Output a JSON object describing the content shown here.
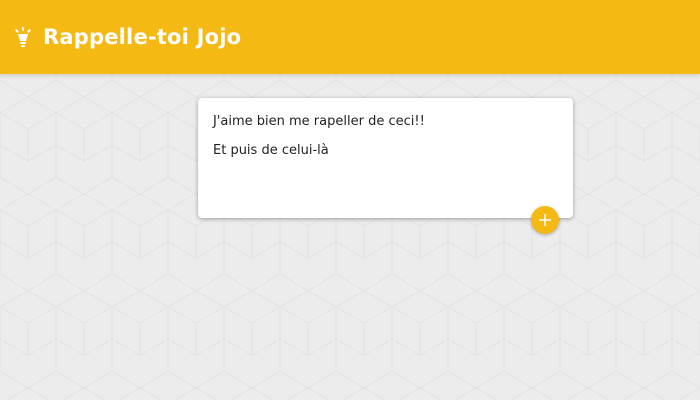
{
  "app": {
    "title": "Rappelle-toi Jojo",
    "logo_icon": "lightbulb-icon"
  },
  "colors": {
    "accent": "#f5b914",
    "background": "#ececec",
    "card": "#ffffff",
    "text": "#222222"
  },
  "note": {
    "lines": [
      "J'aime bien me rapeller de ceci!!",
      "Et puis de celui-là"
    ]
  },
  "add_button": {
    "icon": "plus-icon"
  }
}
